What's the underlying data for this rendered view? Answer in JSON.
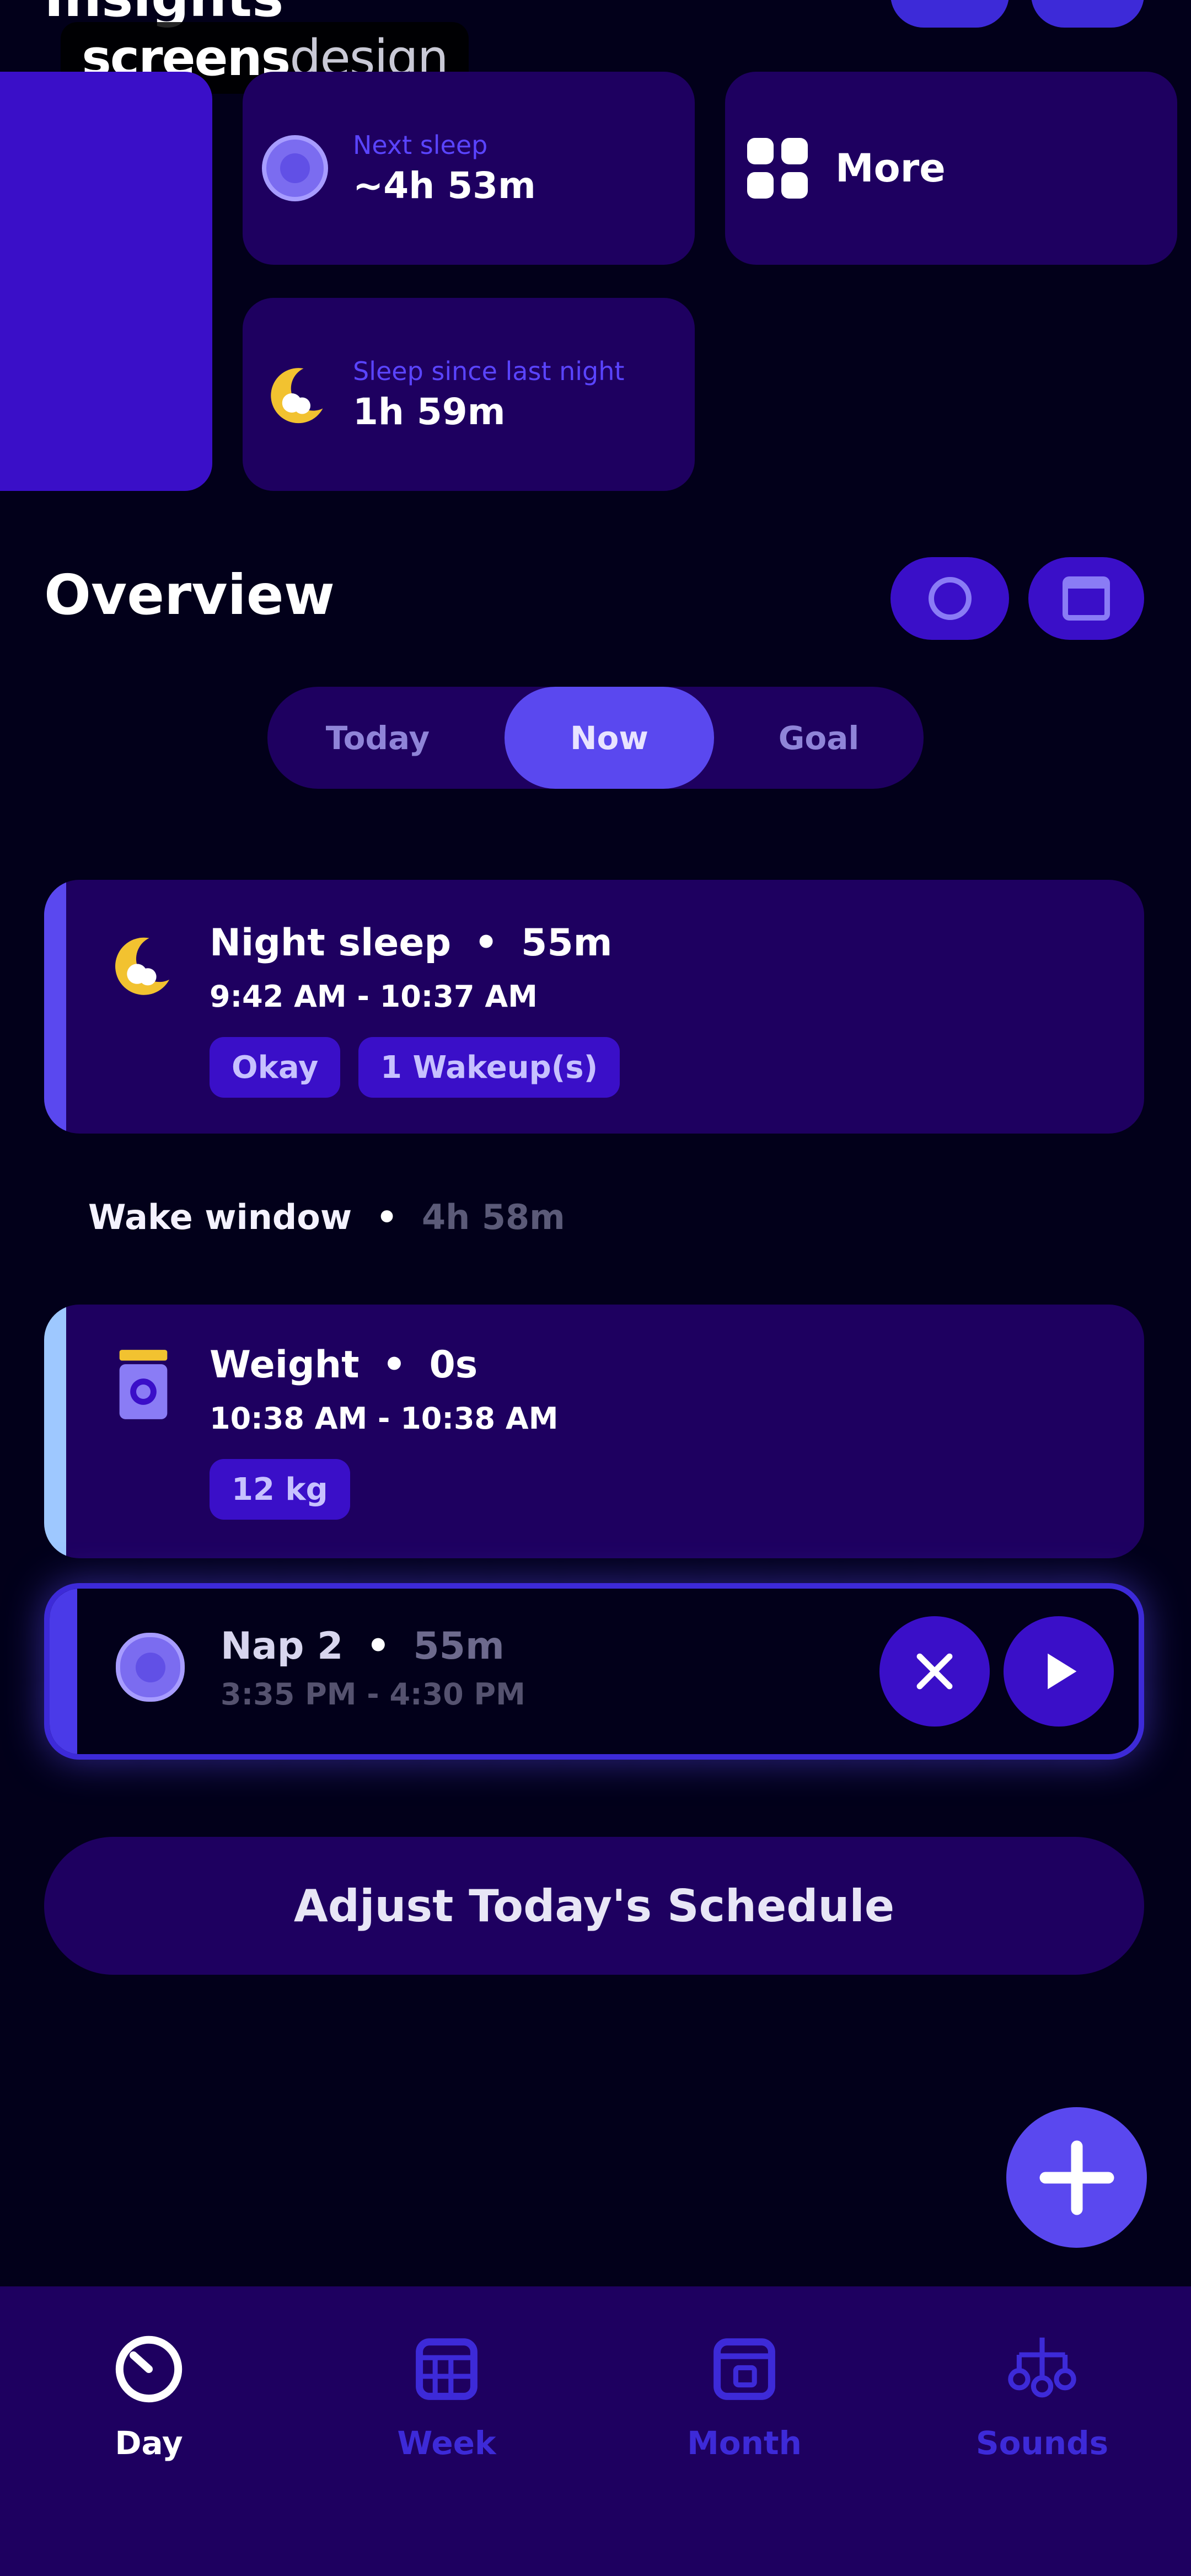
{
  "header": {
    "insights_title": "Insights",
    "watermark_bold": "screens",
    "watermark_light": "design"
  },
  "insights": {
    "next_sleep_label": "Next sleep",
    "next_sleep_value": "~4h 53m",
    "more_label": "More",
    "since_label": "Sleep since last night",
    "since_value": "1h 59m"
  },
  "overview": {
    "title": "Overview",
    "tabs": [
      {
        "label": "Today"
      },
      {
        "label": "Now"
      },
      {
        "label": "Goal"
      }
    ],
    "active_tab": "Now"
  },
  "timeline": {
    "night_sleep": {
      "title": "Night sleep",
      "duration": "55m",
      "time": "9:42 AM - 10:37 AM",
      "tags": [
        "Okay",
        "1 Wakeup(s)"
      ]
    },
    "wake_window": {
      "label": "Wake window",
      "value": "4h 58m"
    },
    "weight": {
      "title": "Weight",
      "duration": "0s",
      "time": "10:38 AM - 10:38 AM",
      "tags": [
        "12 kg"
      ]
    },
    "nap": {
      "title": "Nap 2",
      "duration": "55m",
      "time": "3:35 PM - 4:30 PM"
    },
    "separator": "•"
  },
  "actions": {
    "adjust_label": "Adjust Today's Schedule"
  },
  "nav": {
    "items": [
      {
        "label": "Day"
      },
      {
        "label": "Week"
      },
      {
        "label": "Month"
      },
      {
        "label": "Sounds"
      }
    ],
    "active": "Day"
  },
  "colors": {
    "background": "#02001a",
    "card": "#1e0060",
    "accent": "#5a48ef",
    "bright_purple": "#3a0fc8",
    "moon_yellow": "#f2c230",
    "weight_accent": "#9ec8ff"
  }
}
